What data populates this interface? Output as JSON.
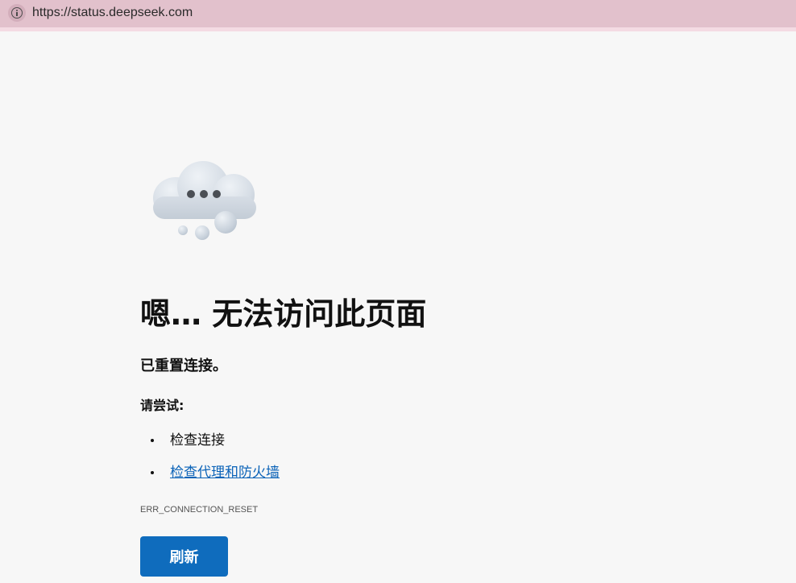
{
  "address_bar": {
    "url": "https://status.deepseek.com",
    "icon": "info-icon"
  },
  "error_page": {
    "illustration": "cloud-icon",
    "headline": "嗯… 无法访问此页面",
    "reason": "已重置连接。",
    "try_label": "请尝试:",
    "suggestions": [
      {
        "label": "检查连接",
        "link": false
      },
      {
        "label": "检查代理和防火墙",
        "link": true
      }
    ],
    "error_code": "ERR_CONNECTION_RESET",
    "refresh_label": "刷新",
    "colors": {
      "button": "#0f6cbd",
      "link": "#0b63b8",
      "address_bar": "#e2c1cc",
      "page_background": "#f7f7f7"
    }
  }
}
